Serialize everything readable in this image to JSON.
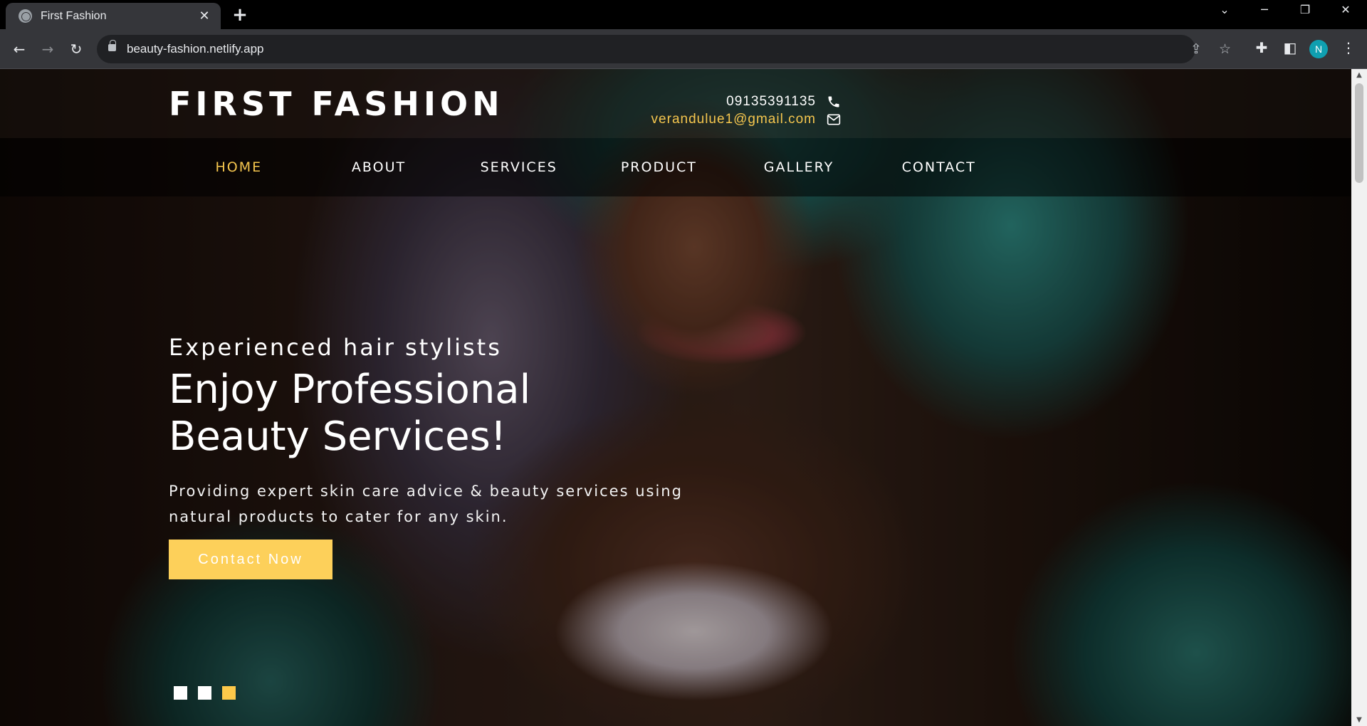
{
  "browser": {
    "tab_title": "First Fashion",
    "url": "beauty-fashion.netlify.app",
    "profile_initial": "N"
  },
  "site": {
    "brand": "FIRST FASHION",
    "phone": "09135391135",
    "email": "verandulue1@gmail.com",
    "nav": [
      "HOME",
      "ABOUT",
      "SERVICES",
      "PRODUCT",
      "GALLERY",
      "CONTACT"
    ],
    "active_nav": "HOME",
    "accent_color": "#f5c64e"
  },
  "hero": {
    "kicker": "Experienced hair stylists",
    "headline_line1": "Enjoy Professional",
    "headline_line2": "Beauty Services!",
    "description": "Providing expert skin care advice & beauty services using natural products to cater for any skin.",
    "cta_label": "Contact Now",
    "slides_count": 3,
    "active_slide": 3
  },
  "icons": {
    "phone": "phone-icon",
    "email": "envelope-icon"
  }
}
